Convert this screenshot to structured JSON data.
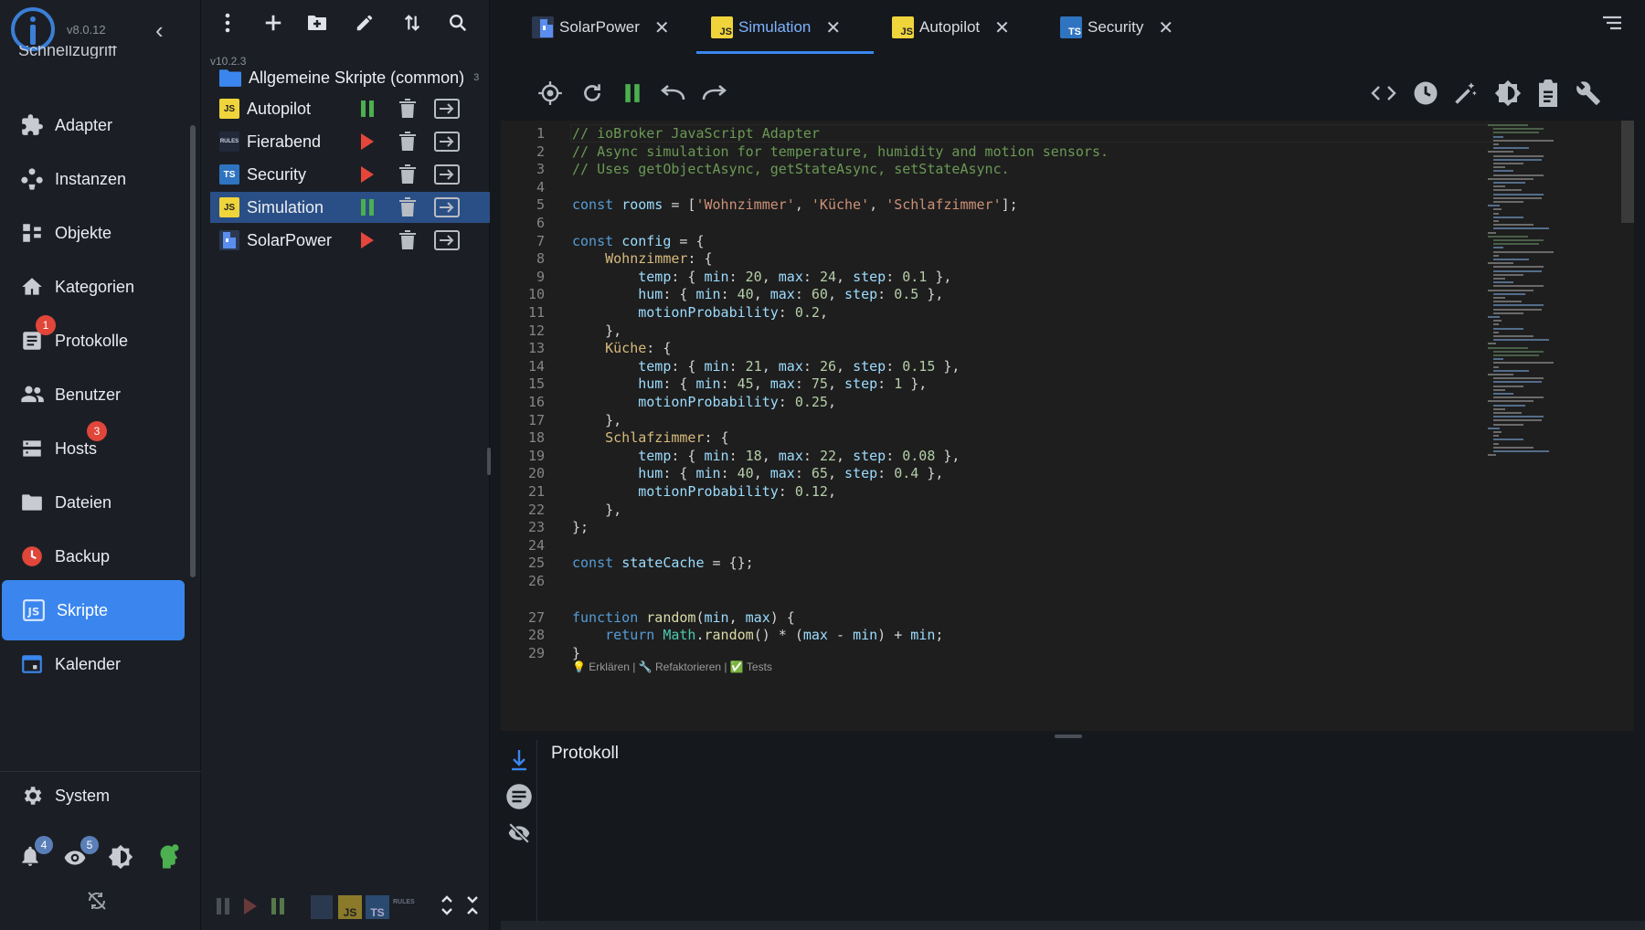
{
  "nav": {
    "version": "v8.0.12",
    "cut_item": "Schnellzugriff",
    "items": [
      {
        "label": "Adapter",
        "icon": "puzzle-icon"
      },
      {
        "label": "Instanzen",
        "icon": "instances-icon"
      },
      {
        "label": "Objekte",
        "icon": "objects-icon"
      },
      {
        "label": "Kategorien",
        "icon": "categories-icon"
      },
      {
        "label": "Protokolle",
        "icon": "log-icon",
        "badge": "1"
      },
      {
        "label": "Benutzer",
        "icon": "users-icon"
      },
      {
        "label": "Hosts",
        "icon": "hosts-icon",
        "badge": "3"
      },
      {
        "label": "Dateien",
        "icon": "folder-icon"
      },
      {
        "label": "Backup",
        "icon": "backup-icon"
      },
      {
        "label": "Skripte",
        "icon": "scripts-icon"
      },
      {
        "label": "Kalender",
        "icon": "calendar-icon"
      }
    ],
    "system_label": "System",
    "notifications_badge": "4",
    "watch_badge": "5"
  },
  "scripts": {
    "version": "v10.2.3",
    "folder_name": "Allgemeine Skripte (common)",
    "folder_count": "3",
    "rows": [
      {
        "name": "Autopilot",
        "type": "JS",
        "state": "running"
      },
      {
        "name": "Fierabend",
        "type": "RULES",
        "state": "stopped"
      },
      {
        "name": "Security",
        "type": "TS",
        "state": "stopped"
      },
      {
        "name": "Simulation",
        "type": "JS",
        "state": "running"
      },
      {
        "name": "SolarPower",
        "type": "BLOCKLY",
        "state": "stopped"
      }
    ],
    "bottom_filters": [
      "JS",
      "TS",
      "RULES"
    ]
  },
  "tabs": [
    {
      "label": "SolarPower",
      "type": "BLOCKLY"
    },
    {
      "label": "Simulation",
      "type": "JS",
      "active": true
    },
    {
      "label": "Autopilot",
      "type": "JS"
    },
    {
      "label": "Security",
      "type": "TS"
    }
  ],
  "editor": {
    "code_lens": "💡 Erklären | 🔧 Refaktorieren | ✅ Tests",
    "line_numbers": [
      "1",
      "2",
      "3",
      "4",
      "5",
      "6",
      "7",
      "8",
      "9",
      "10",
      "11",
      "12",
      "13",
      "14",
      "15",
      "16",
      "17",
      "18",
      "19",
      "20",
      "21",
      "22",
      "23",
      "24",
      "25",
      "26",
      "27",
      "28",
      "29"
    ],
    "lines": [
      "// ioBroker JavaScript Adapter",
      "// Async simulation for temperature, humidity and motion sensors.",
      "// Uses getObjectAsync, getStateAsync, setStateAsync.",
      "",
      "const rooms = ['Wohnzimmer', 'Küche', 'Schlafzimmer'];",
      "",
      "const config = {",
      "    Wohnzimmer: {",
      "        temp: { min: 20, max: 24, step: 0.1 },",
      "        hum: { min: 40, max: 60, step: 0.5 },",
      "        motionProbability: 0.2,",
      "    },",
      "    Küche: {",
      "        temp: { min: 21, max: 26, step: 0.15 },",
      "        hum: { min: 45, max: 75, step: 1 },",
      "        motionProbability: 0.25,",
      "    },",
      "    Schlafzimmer: {",
      "        temp: { min: 18, max: 22, step: 0.08 },",
      "        hum: { min: 40, max: 65, step: 0.4 },",
      "        motionProbability: 0.12,",
      "    },",
      "};",
      "",
      "const stateCache = {};",
      "",
      "function random(min, max) {",
      "    return Math.random() * (max - min) + min;",
      "}"
    ]
  },
  "log": {
    "title": "Protokoll"
  },
  "colors": {
    "accent": "#3a86ee",
    "badge": "#e0463a",
    "play": "#e4463b",
    "pause": "#4caf50",
    "js": "#f0d43b",
    "ts": "#2f74c0"
  }
}
